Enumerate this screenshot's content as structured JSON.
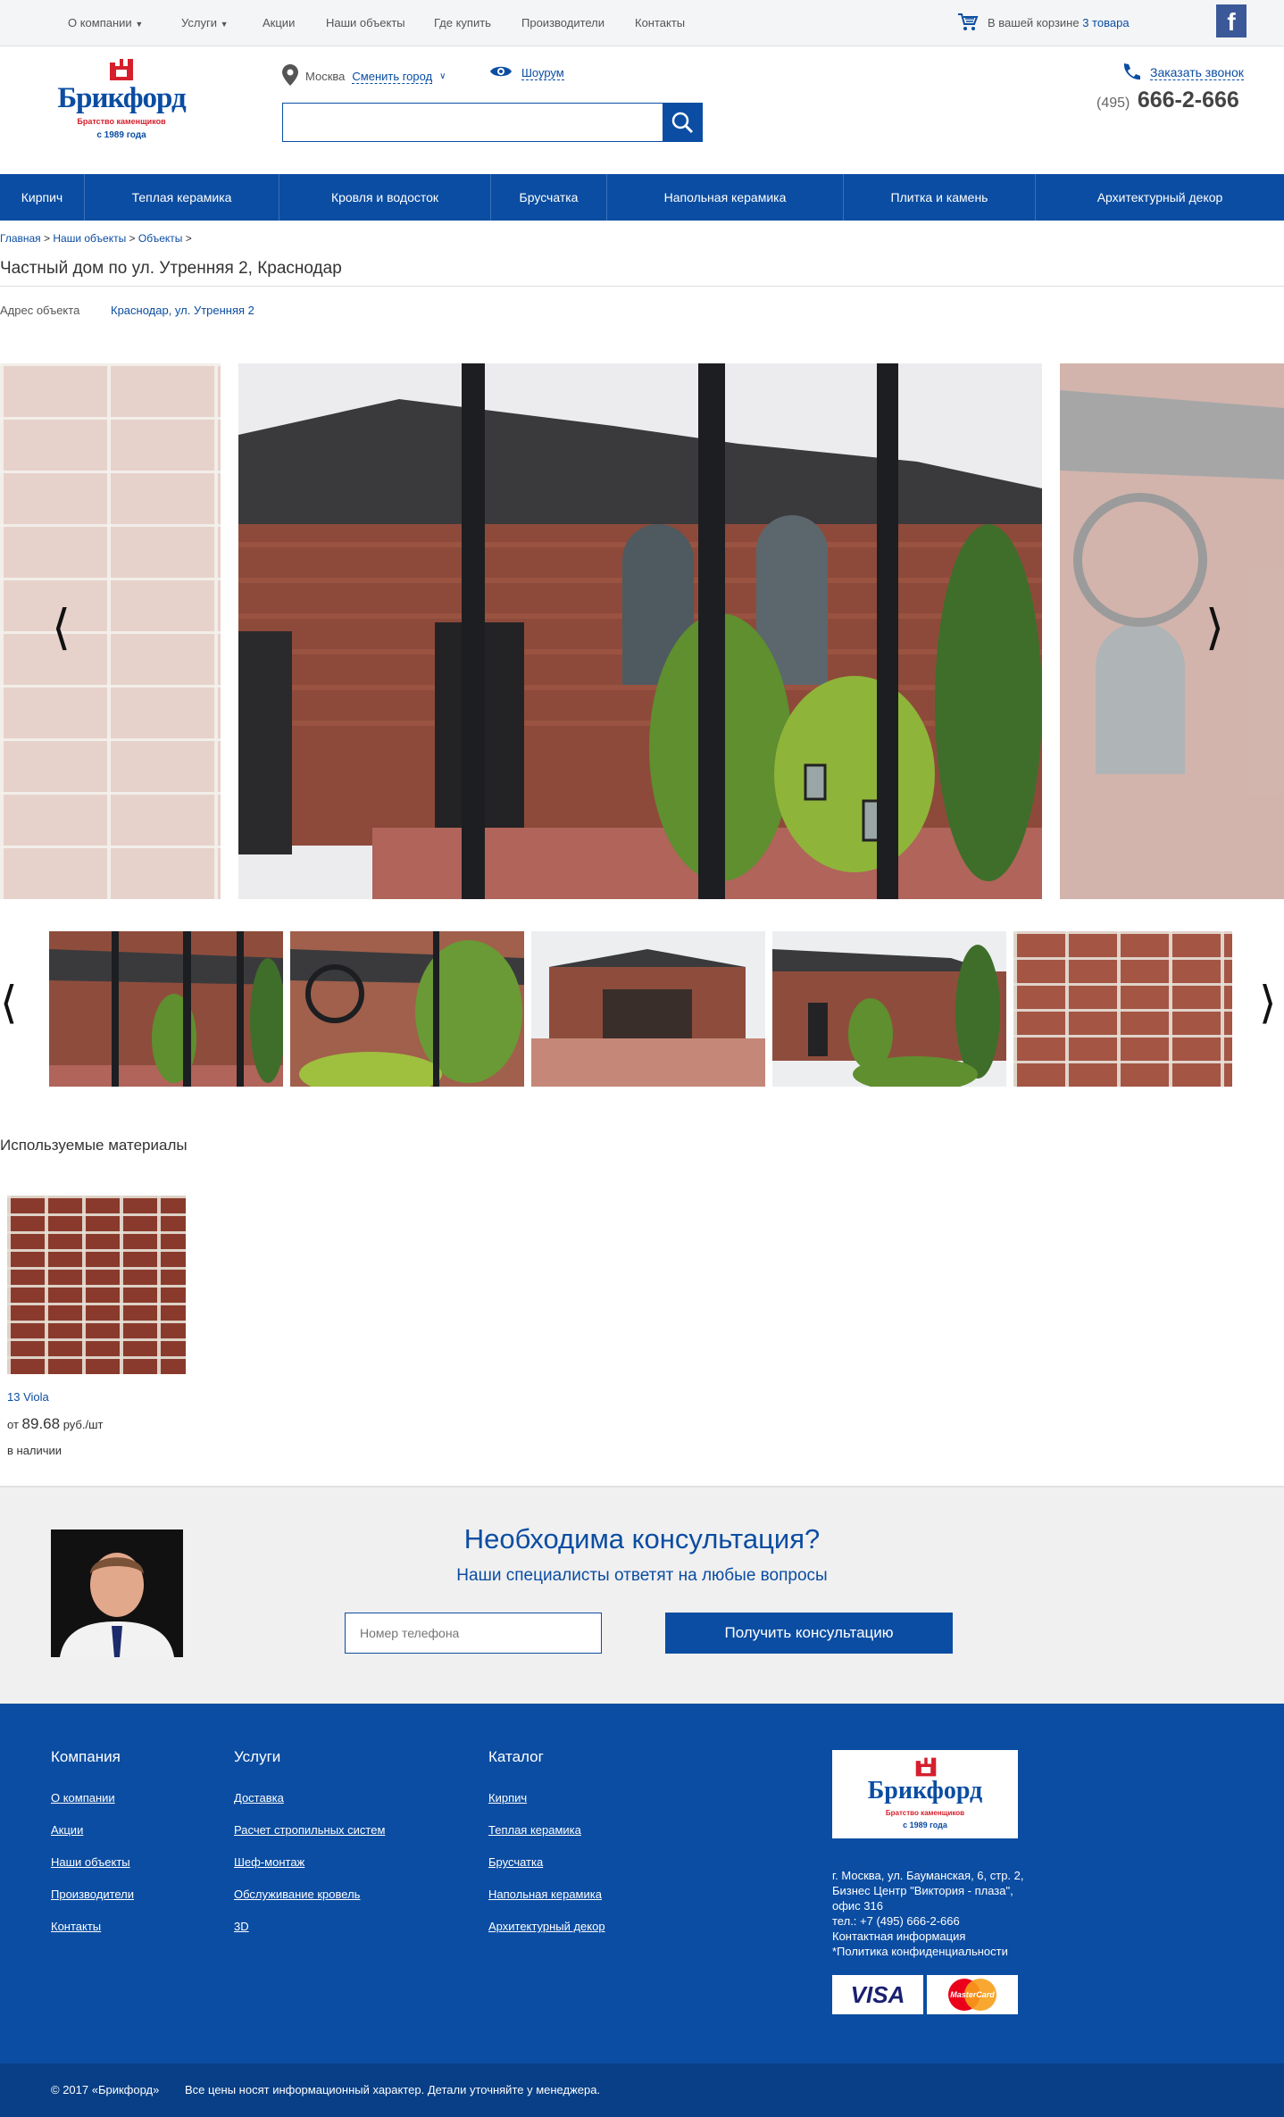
{
  "topnav": {
    "items": [
      "О компании",
      "Услуги",
      "Акции",
      "Наши объекты",
      "Где купить",
      "Производители",
      "Контакты"
    ],
    "cart_text": "В вашей корзине",
    "cart_count": "3 товара",
    "facebook": "f"
  },
  "header": {
    "logo_name": "Брикфорд",
    "logo_tagline": "Братство каменщиков",
    "logo_since": "с 1989 года",
    "city": "Москва",
    "change_city": "Сменить город",
    "showroom": "Шоурум",
    "search_placeholder": "",
    "callback": "Заказать звонок",
    "phone_code": "(495)",
    "phone_number": "666-2-666"
  },
  "mainmenu": [
    "Кирпич",
    "Теплая керамика",
    "Кровля и водосток",
    "Брусчатка",
    "Напольная керамика",
    "Плитка и камень",
    "Архитектурный декор"
  ],
  "breadcrumbs": [
    "Главная",
    "Наши объекты",
    "Объекты"
  ],
  "page": {
    "title": "Частный дом по ул. Утренняя 2, Краснодар",
    "address_label": "Адрес объекта",
    "address_link": "Краснодар, ул. Утренняя 2"
  },
  "gallery": {
    "prev_arrow": "⟨",
    "next_arrow": "⟩"
  },
  "materials": {
    "title": "Используемые материалы",
    "items": [
      {
        "name": "13 Viola",
        "price_prefix": "от",
        "price": "89.68",
        "price_unit": "руб./шт",
        "stock": "в наличии"
      }
    ]
  },
  "consult": {
    "title": "Необходима консультация?",
    "subtitle": "Наши специалисты ответят на любые вопросы",
    "phone_placeholder": "Номер телефона",
    "button": "Получить консультацию"
  },
  "footer": {
    "company": {
      "title": "Компания",
      "links": [
        "О компании",
        "Акции",
        "Наши объекты",
        "Производители",
        "Контакты"
      ]
    },
    "services": {
      "title": "Услуги",
      "links": [
        "Доставка",
        "Расчет стропильных систем",
        "Шеф-монтаж",
        "Обслуживание кровель",
        "3D"
      ]
    },
    "catalog": {
      "title": "Каталог",
      "links": [
        "Кирпич",
        "Теплая керамика",
        "Брусчатка",
        "Напольная керамика",
        "Архитектурный декор"
      ]
    },
    "address": "г. Москва, ул. Бауманская, 6, стр. 2, Бизнес Центр \"Виктория - плаза\", офис 316",
    "tel": "тел.: +7 (495) 666-2-666",
    "contact_info": "Контактная информация",
    "privacy": "*Политика конфиденциальности",
    "visa": "VISA",
    "mastercard": "MasterCard",
    "copyright": "© 2017 «Брикфорд»",
    "disclaimer": "Все цены носят информационный характер. Детали уточняйте у менеджера."
  },
  "colors": {
    "brand": "#0b4da2",
    "accent": "#d61f2c",
    "footer_bottom": "#083f86"
  }
}
